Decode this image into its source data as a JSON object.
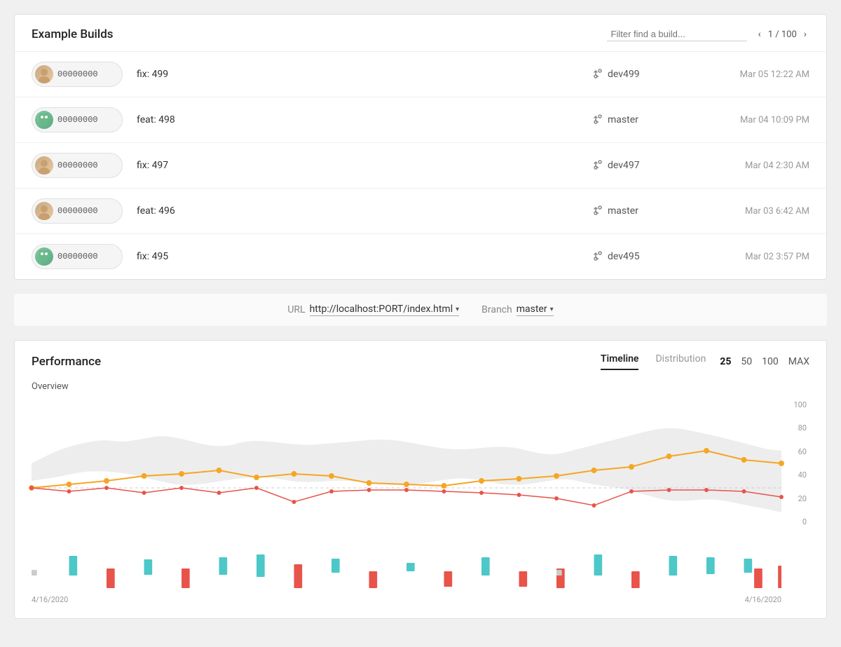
{
  "builds": {
    "title": "Example Builds",
    "filter_placeholder": "Filter find a build...",
    "pagination": {
      "current": 1,
      "total": 100,
      "label": "1 / 100"
    },
    "rows": [
      {
        "id": "build-1",
        "hash": "00000000",
        "label": "fix: 499",
        "branch": "dev499",
        "time": "Mar 05 12:22 AM",
        "avatar_type": "human"
      },
      {
        "id": "build-2",
        "hash": "00000000",
        "label": "feat: 498",
        "branch": "master",
        "time": "Mar 04 10:09 PM",
        "avatar_type": "robot"
      },
      {
        "id": "build-3",
        "hash": "00000000",
        "label": "fix: 497",
        "branch": "dev497",
        "time": "Mar 04 2:30 AM",
        "avatar_type": "human"
      },
      {
        "id": "build-4",
        "hash": "00000000",
        "label": "feat: 496",
        "branch": "master",
        "time": "Mar 03 6:42 AM",
        "avatar_type": "human"
      },
      {
        "id": "build-5",
        "hash": "00000000",
        "label": "fix: 495",
        "branch": "dev495",
        "time": "Mar 02 3:57 PM",
        "avatar_type": "robot"
      }
    ]
  },
  "controls": {
    "url_label": "URL",
    "url_value": "http://localhost:PORT/index.html",
    "branch_label": "Branch",
    "branch_value": "master"
  },
  "performance": {
    "title": "Performance",
    "tabs": [
      {
        "id": "timeline",
        "label": "Timeline",
        "active": true
      },
      {
        "id": "distribution",
        "label": "Distribution",
        "active": false
      }
    ],
    "counts": [
      "25",
      "50",
      "100",
      "MAX"
    ],
    "active_count": "25",
    "chart": {
      "overview_label": "Overview",
      "y_labels": [
        "100",
        "80",
        "60",
        "40",
        "20",
        "0"
      ],
      "x_labels": [
        "4/16/2020",
        "4/16/2020"
      ]
    }
  }
}
